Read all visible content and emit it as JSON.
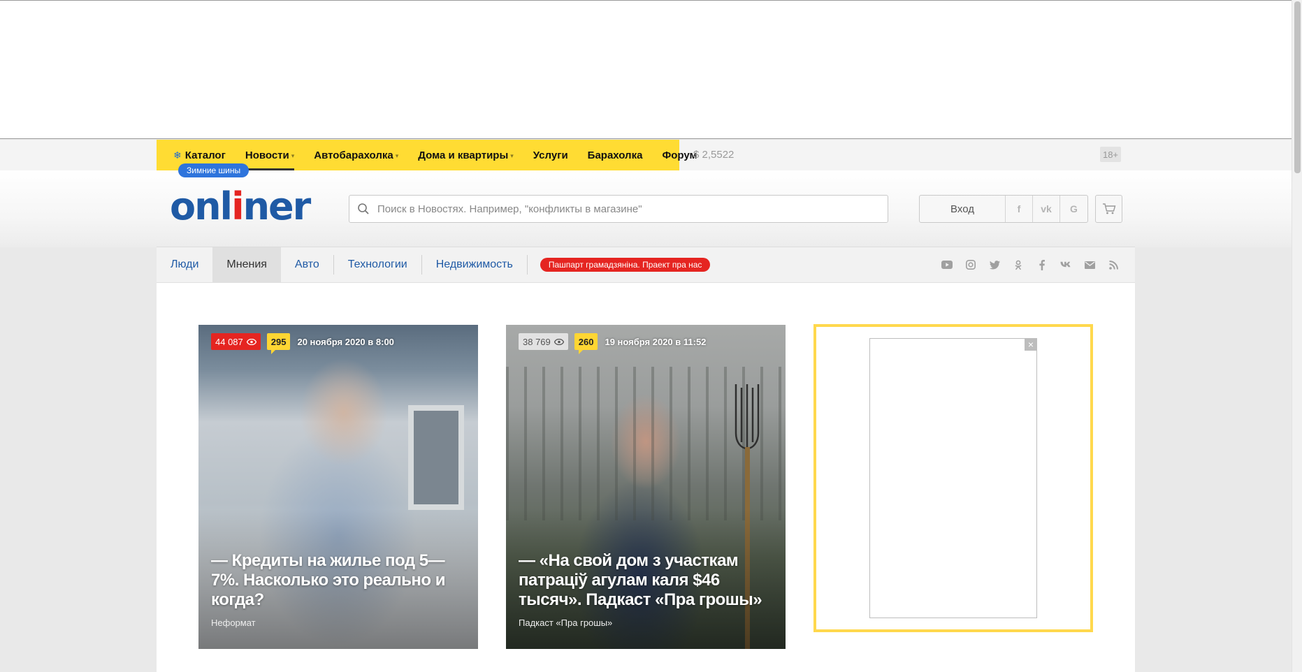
{
  "top_nav": {
    "items": [
      {
        "label": "Каталог",
        "dropdown": false
      },
      {
        "label": "Новости",
        "dropdown": true
      },
      {
        "label": "Автобарахолка",
        "dropdown": true
      },
      {
        "label": "Дома и квартиры",
        "dropdown": true
      },
      {
        "label": "Услуги",
        "dropdown": false
      },
      {
        "label": "Барахолка",
        "dropdown": false
      },
      {
        "label": "Форум",
        "dropdown": false
      }
    ],
    "active": "Новости",
    "catalog_tag": "Зимние шины",
    "currency": "$ 2,5522",
    "age": "18+",
    "accent_color": "#ffdc33"
  },
  "header": {
    "logo_pre": "onl",
    "logo_accent": "i",
    "logo_post": "ner",
    "search_placeholder": "Поиск в Новостях. Например, \"конфликты в магазине\"",
    "login": "Вход",
    "social_logins": [
      "f",
      "vk",
      "G"
    ]
  },
  "sub_nav": {
    "tabs": [
      "Люди",
      "Мнения",
      "Авто",
      "Технологии",
      "Недвижимость"
    ],
    "active": "Мнения",
    "promo": "Пашпарт грамадзяніна. Праект пра нас",
    "social_icons": [
      "youtube-icon",
      "instagram-icon",
      "twitter-icon",
      "odnoklassniki-icon",
      "facebook-icon",
      "vk-icon",
      "mail-icon",
      "rss-icon"
    ]
  },
  "cards": [
    {
      "views": "44 087",
      "comments": "295",
      "date": "20 ноября 2020 в 8:00",
      "title": "— Кредиты на жилье под 5—7%. Насколько это реально и когда?",
      "rubric": "Неформат"
    },
    {
      "views": "38 769",
      "comments": "260",
      "date": "19 ноября 2020 в 11:52",
      "title": "— «На свой дом з участкам патрацiў агулам каля $46 тысяч». Падкаст «Пра грошы»",
      "rubric": "Падкаст «Пра грошы»"
    }
  ],
  "ad": {
    "close": "×"
  }
}
